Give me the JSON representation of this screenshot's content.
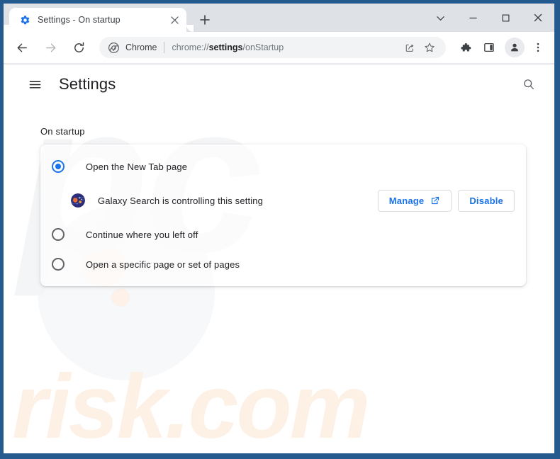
{
  "window": {
    "border_color": "#255a8e",
    "controls": {
      "dropdown_label": "v",
      "minimize_label": "–",
      "maximize_label": "□",
      "close_label": "×"
    }
  },
  "tabstrip": {
    "active_tab": {
      "title": "Settings - On startup",
      "favicon": "settings-gear-icon",
      "close_label": "×"
    },
    "new_tab_label": "+"
  },
  "toolbar": {
    "back_icon": "back-arrow-icon",
    "forward_icon": "forward-arrow-icon",
    "reload_icon": "reload-icon",
    "omnibox": {
      "chip_icon": "chrome-logo-icon",
      "chip_label": "Chrome",
      "url_scheme": "chrome://",
      "url_bold": "settings",
      "url_rest": "/onStartup",
      "full_url": "chrome://settings/onStartup",
      "share_icon": "share-icon",
      "bookmark_icon": "star-icon"
    },
    "extensions_icon": "puzzle-piece-icon",
    "sidepanel_icon": "side-panel-icon",
    "avatar_icon": "person-avatar-icon",
    "menu_icon": "three-dot-menu-icon"
  },
  "settings": {
    "menu_icon": "hamburger-menu-icon",
    "title": "Settings",
    "search_icon": "search-icon",
    "section_title": "On startup",
    "options": [
      {
        "label": "Open the New Tab page",
        "checked": true
      },
      {
        "label": "Continue where you left off",
        "checked": false
      },
      {
        "label": "Open a specific page or set of pages",
        "checked": false
      }
    ],
    "controlled_by": {
      "favicon": "galaxy-search-favicon",
      "text": "Galaxy Search is controlling this setting",
      "manage_label": "Manage",
      "manage_icon": "open-in-new-icon",
      "disable_label": "Disable"
    },
    "accent_color": "#1a73e8"
  },
  "watermark": {
    "initials": "pc",
    "domain": "risk.com"
  }
}
